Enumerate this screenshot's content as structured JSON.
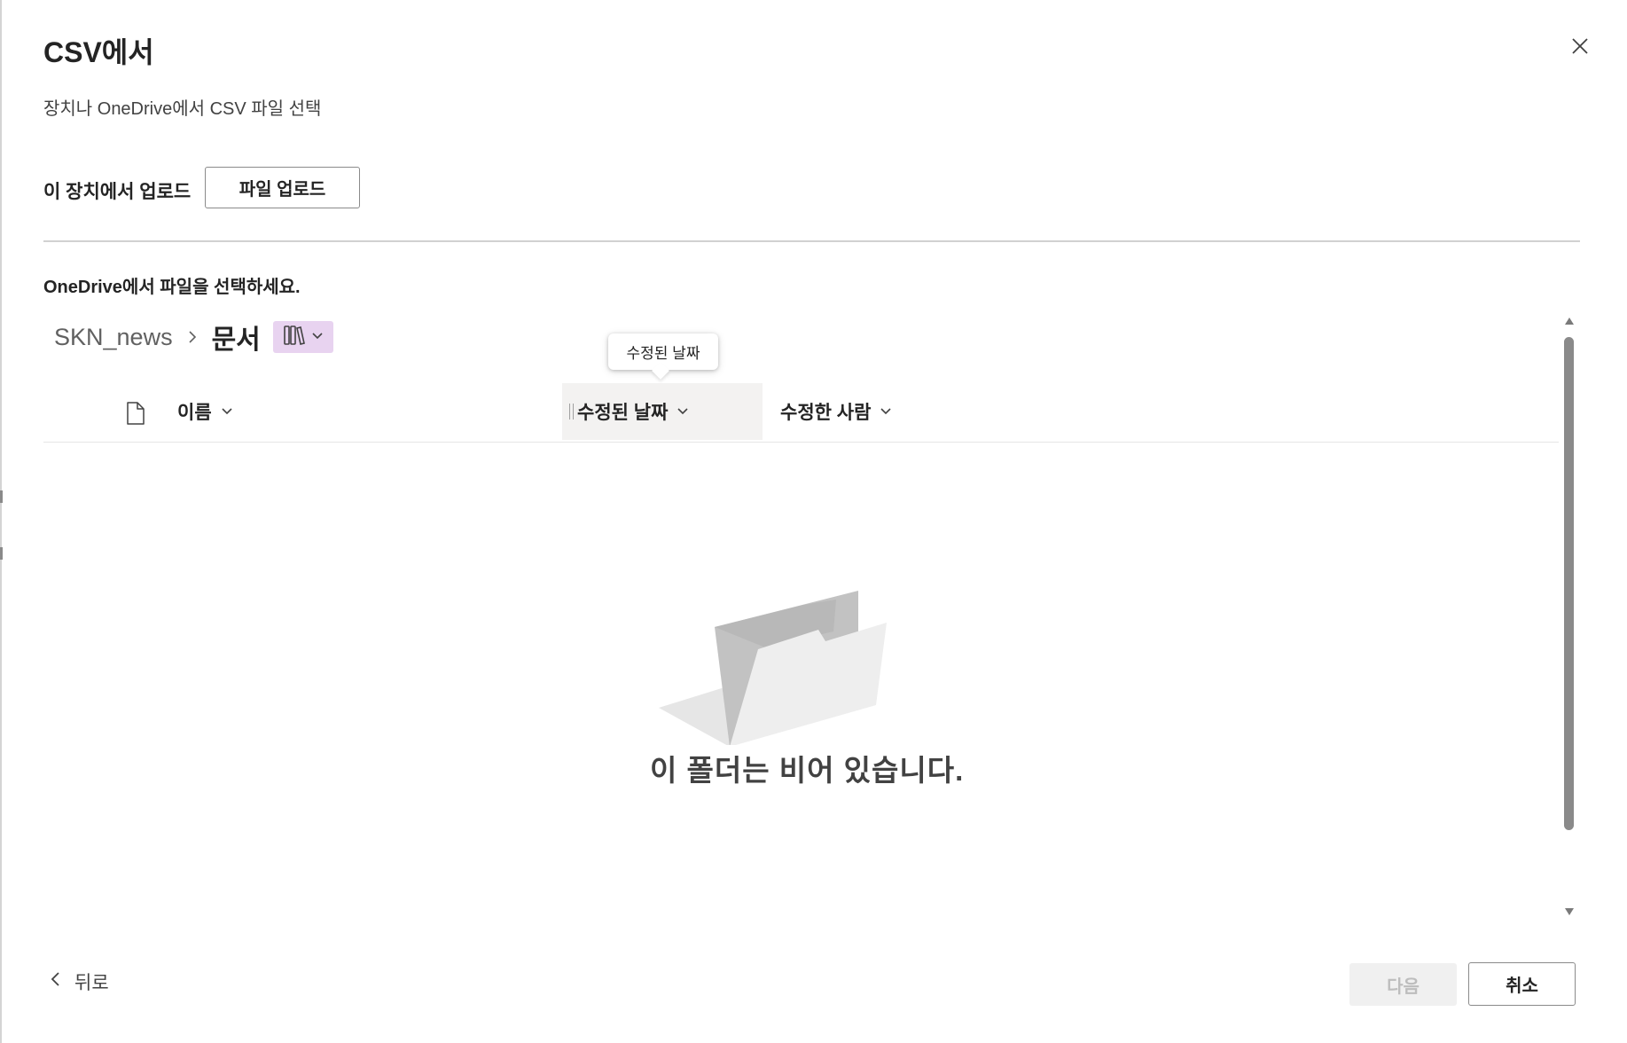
{
  "dialog": {
    "title": "CSV에서",
    "subtitle": "장치나 OneDrive에서 CSV 파일 선택"
  },
  "icons": {
    "close": "close-icon",
    "breadcrumb_separator": "chevron-right-icon",
    "library": "library-icon",
    "dropdown": "chevron-down-icon",
    "file_type": "document-icon",
    "empty_state": "empty-folder-icon",
    "back": "chevron-left-icon"
  },
  "upload": {
    "label": "이 장치에서 업로드",
    "button_label": "파일 업로드"
  },
  "onedrive": {
    "label": "OneDrive에서 파일을 선택하세요."
  },
  "breadcrumb": {
    "root": "SKN_news",
    "current": "문서"
  },
  "tooltip": {
    "text": "수정된 날짜"
  },
  "columns": {
    "name": "이름",
    "modified": "수정된 날짜",
    "modified_by": "수정한 사람"
  },
  "empty_state": {
    "message": "이 폴더는 비어 있습니다."
  },
  "footer": {
    "back_label": "뒤로",
    "next_label": "다음",
    "cancel_label": "취소"
  },
  "colors": {
    "library_pill_bg": "#e8d3f0",
    "active_column_bg": "#f3f2f1",
    "disabled_button_bg": "#f0f0f0"
  }
}
